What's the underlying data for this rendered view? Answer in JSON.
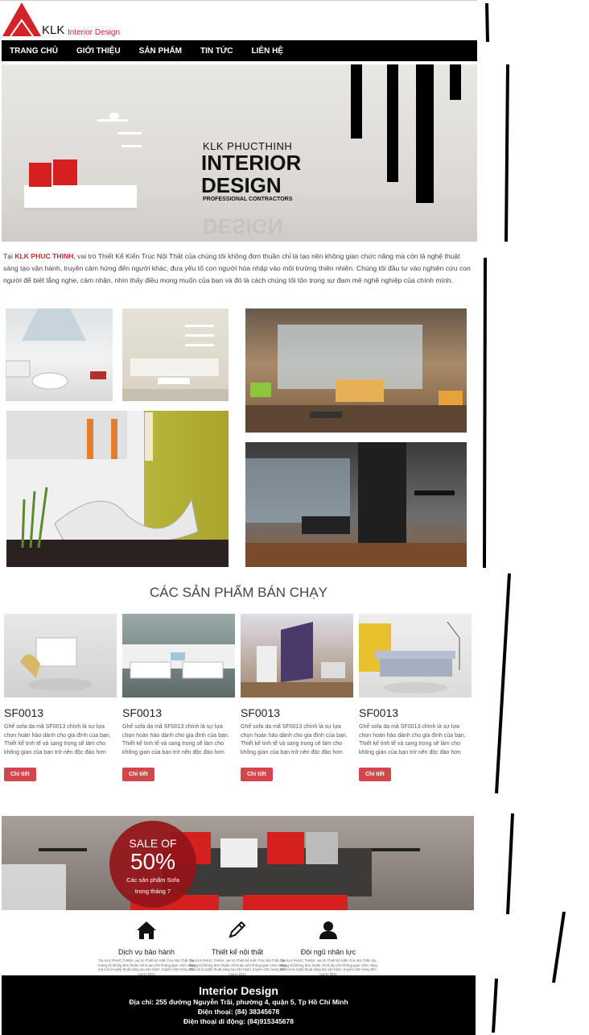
{
  "logo": {
    "brand": "KLK",
    "tagline": "Interior Design"
  },
  "nav": [
    "TRANG CHỦ",
    "GIỚI THIỆU",
    "SẢN PHẨM",
    "TIN TỨC",
    "LIÊN HỆ"
  ],
  "banner": {
    "line1": "KLK PHUCTHINH",
    "line2": "INTERIOR",
    "line3": "DESIGN",
    "line4": "PROFESSIONAL CONTRACTORS",
    "reflection": "DESIGN"
  },
  "intro": {
    "prefix": "Tại ",
    "brand": "KLK PHUC THINH",
    "text": ", vai trò Thiết Kế Kiến Trúc Nội Thất của chúng tôi không đơn thuần chỉ là tạo nên không gian chức năng mà còn là nghệ thuật sáng tạo vận hành, truyền cảm hứng đến người khác, đưa yếu tố con người hòa nhập vào môi trường thiên nhiên. Chúng tôi đầu tư vào nghiên cứu con người để biết lắng nghe, cảm nhận, nhìn thấy điều mong muốn của bạn và đó là cách chúng tôi tôn trọng sự đam mê nghề nghiệp của chính mình."
  },
  "bestsellers": {
    "title": "CÁC SẢN PHẨM BÁN CHẠY",
    "products": [
      {
        "code": "SF0013",
        "desc": "Ghế sofa da mã SF0013 chính là sự lựa chọn hoàn hảo dành cho gia đình của bạn. Thiết kế tinh tế và sang trọng sẽ làm cho không gian của bạn trở nên độc đáo hơn",
        "button": "Chi tiết"
      },
      {
        "code": "SF0013",
        "desc": "Ghế sofa da mã SF0013 chính là sự lựa chọn hoàn hảo dành cho gia đình của bạn. Thiết kế tinh tế và sang trọng sẽ làm cho không gian của bạn trở nên độc đáo hơn",
        "button": "Chi tiết"
      },
      {
        "code": "SF0013",
        "desc": "Ghế sofa da mã SF0013 chính là sự lựa chọn hoàn hảo dành cho gia đình của bạn. Thiết kế tinh tế và sang trọng sẽ làm cho không gian của bạn trở nên độc đáo hơn",
        "button": "Chi tiết"
      },
      {
        "code": "SF0013",
        "desc": "Ghế sofa da mã SF0013 chính là sự lựa chọn hoàn hảo dành cho gia đình của bạn. Thiết kế tinh tế và sang trọng sẽ làm cho không gian của bạn trở nên độc đáo hơn",
        "button": "Chi tiết"
      }
    ]
  },
  "sale": {
    "line1": "SALE OF",
    "percent": "50%",
    "line2": "Các sản phẩm Sofa",
    "line3": "trong tháng 7"
  },
  "services": [
    {
      "icon": "home-icon",
      "title": "Dịch vụ bảo hành",
      "desc": "Tại KLK PHUC THINH, vai trò Thiết Kế Kiến Trúc Nội Thất của chúng tôi không đơn thuần chỉ là tạo nên không gian chức năng mà còn là nghệ thuật sáng tạo vận hành, truyền cảm hứng đến người khác"
    },
    {
      "icon": "pencil-icon",
      "title": "Thiết kế nội thất",
      "desc": "Tại KLK PHUC THINH, vai trò Thiết Kế Kiến Trúc Nội Thất của chúng tôi không đơn thuần chỉ là tạo nên không gian chức năng mà còn là nghệ thuật sáng tạo vận hành, truyền cảm hứng đến người khác"
    },
    {
      "icon": "user-icon",
      "title": "Đội ngũ nhân lực",
      "desc": "Tại KLK PHUC THINH, vai trò Thiết Kế Kiến Trúc Nội Thất của chúng tôi không đơn thuần chỉ là tạo nên không gian chức năng mà còn là nghệ thuật sáng tạo vận hành, truyền cảm hứng đến người khác"
    }
  ],
  "footer": {
    "title": "Interior Design",
    "address": "Địa chỉ: 255 đường Nguyễn Trãi, phường 4, quận 5, Tp Hồ Chí Minh",
    "phone": "Điện thoại: (84) 38345678",
    "mobile": "Điện thoại di động: (84)915345678"
  },
  "colors": {
    "accent": "#d3232a",
    "button": "#d3464b",
    "nav_bg": "#000000"
  }
}
